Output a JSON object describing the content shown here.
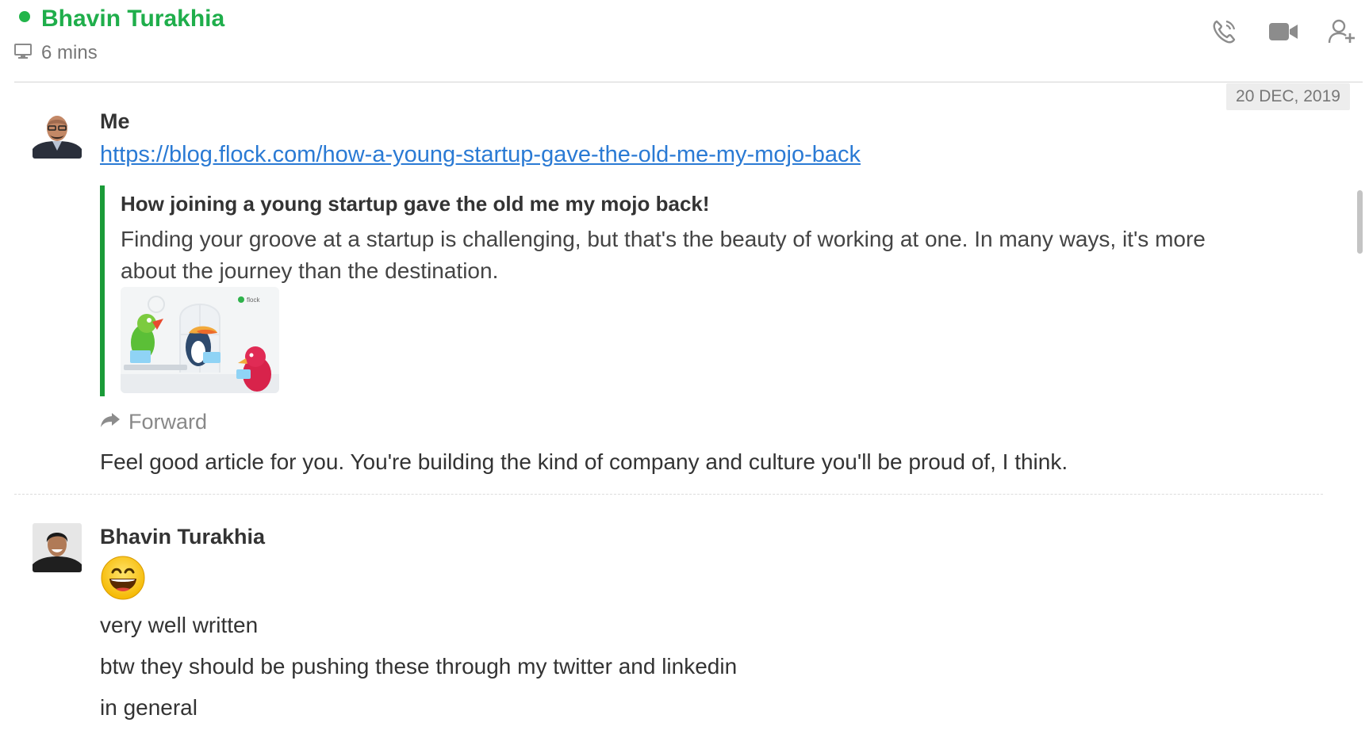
{
  "header": {
    "contact_name": "Bhavin Turakhia",
    "presence_icon": "monitor-icon",
    "last_seen": "6 mins",
    "status_color": "#22b54a",
    "actions": [
      {
        "name": "voice-call-icon",
        "label": "Voice call"
      },
      {
        "name": "video-call-icon",
        "label": "Video call"
      },
      {
        "name": "add-member-icon",
        "label": "Add member"
      }
    ]
  },
  "date_separator": "20 DEC, 2019",
  "messages": [
    {
      "sender": "Me",
      "link": "https://blog.flock.com/how-a-young-startup-gave-the-old-me-my-mojo-back",
      "preview": {
        "title": "How joining a young startup gave the old me my mojo back!",
        "description": "Finding your groove at a startup is challenging, but that's the beauty of working at one. In many ways, it's more about the journey than the destination.",
        "image_brand": "flock",
        "accent_color": "#1a9b38"
      },
      "forward_label": "Forward",
      "text": "Feel good article for you. You're building the kind of company and culture you'll be proud of, I think."
    },
    {
      "sender": "Bhavin Turakhia",
      "emoji": "grinning-face-icon",
      "lines": [
        "very well written",
        "btw they should be pushing these through my twitter and linkedin",
        "in general"
      ]
    }
  ],
  "colors": {
    "brand_green": "#1fae4b",
    "link_blue": "#2a7ad4"
  }
}
